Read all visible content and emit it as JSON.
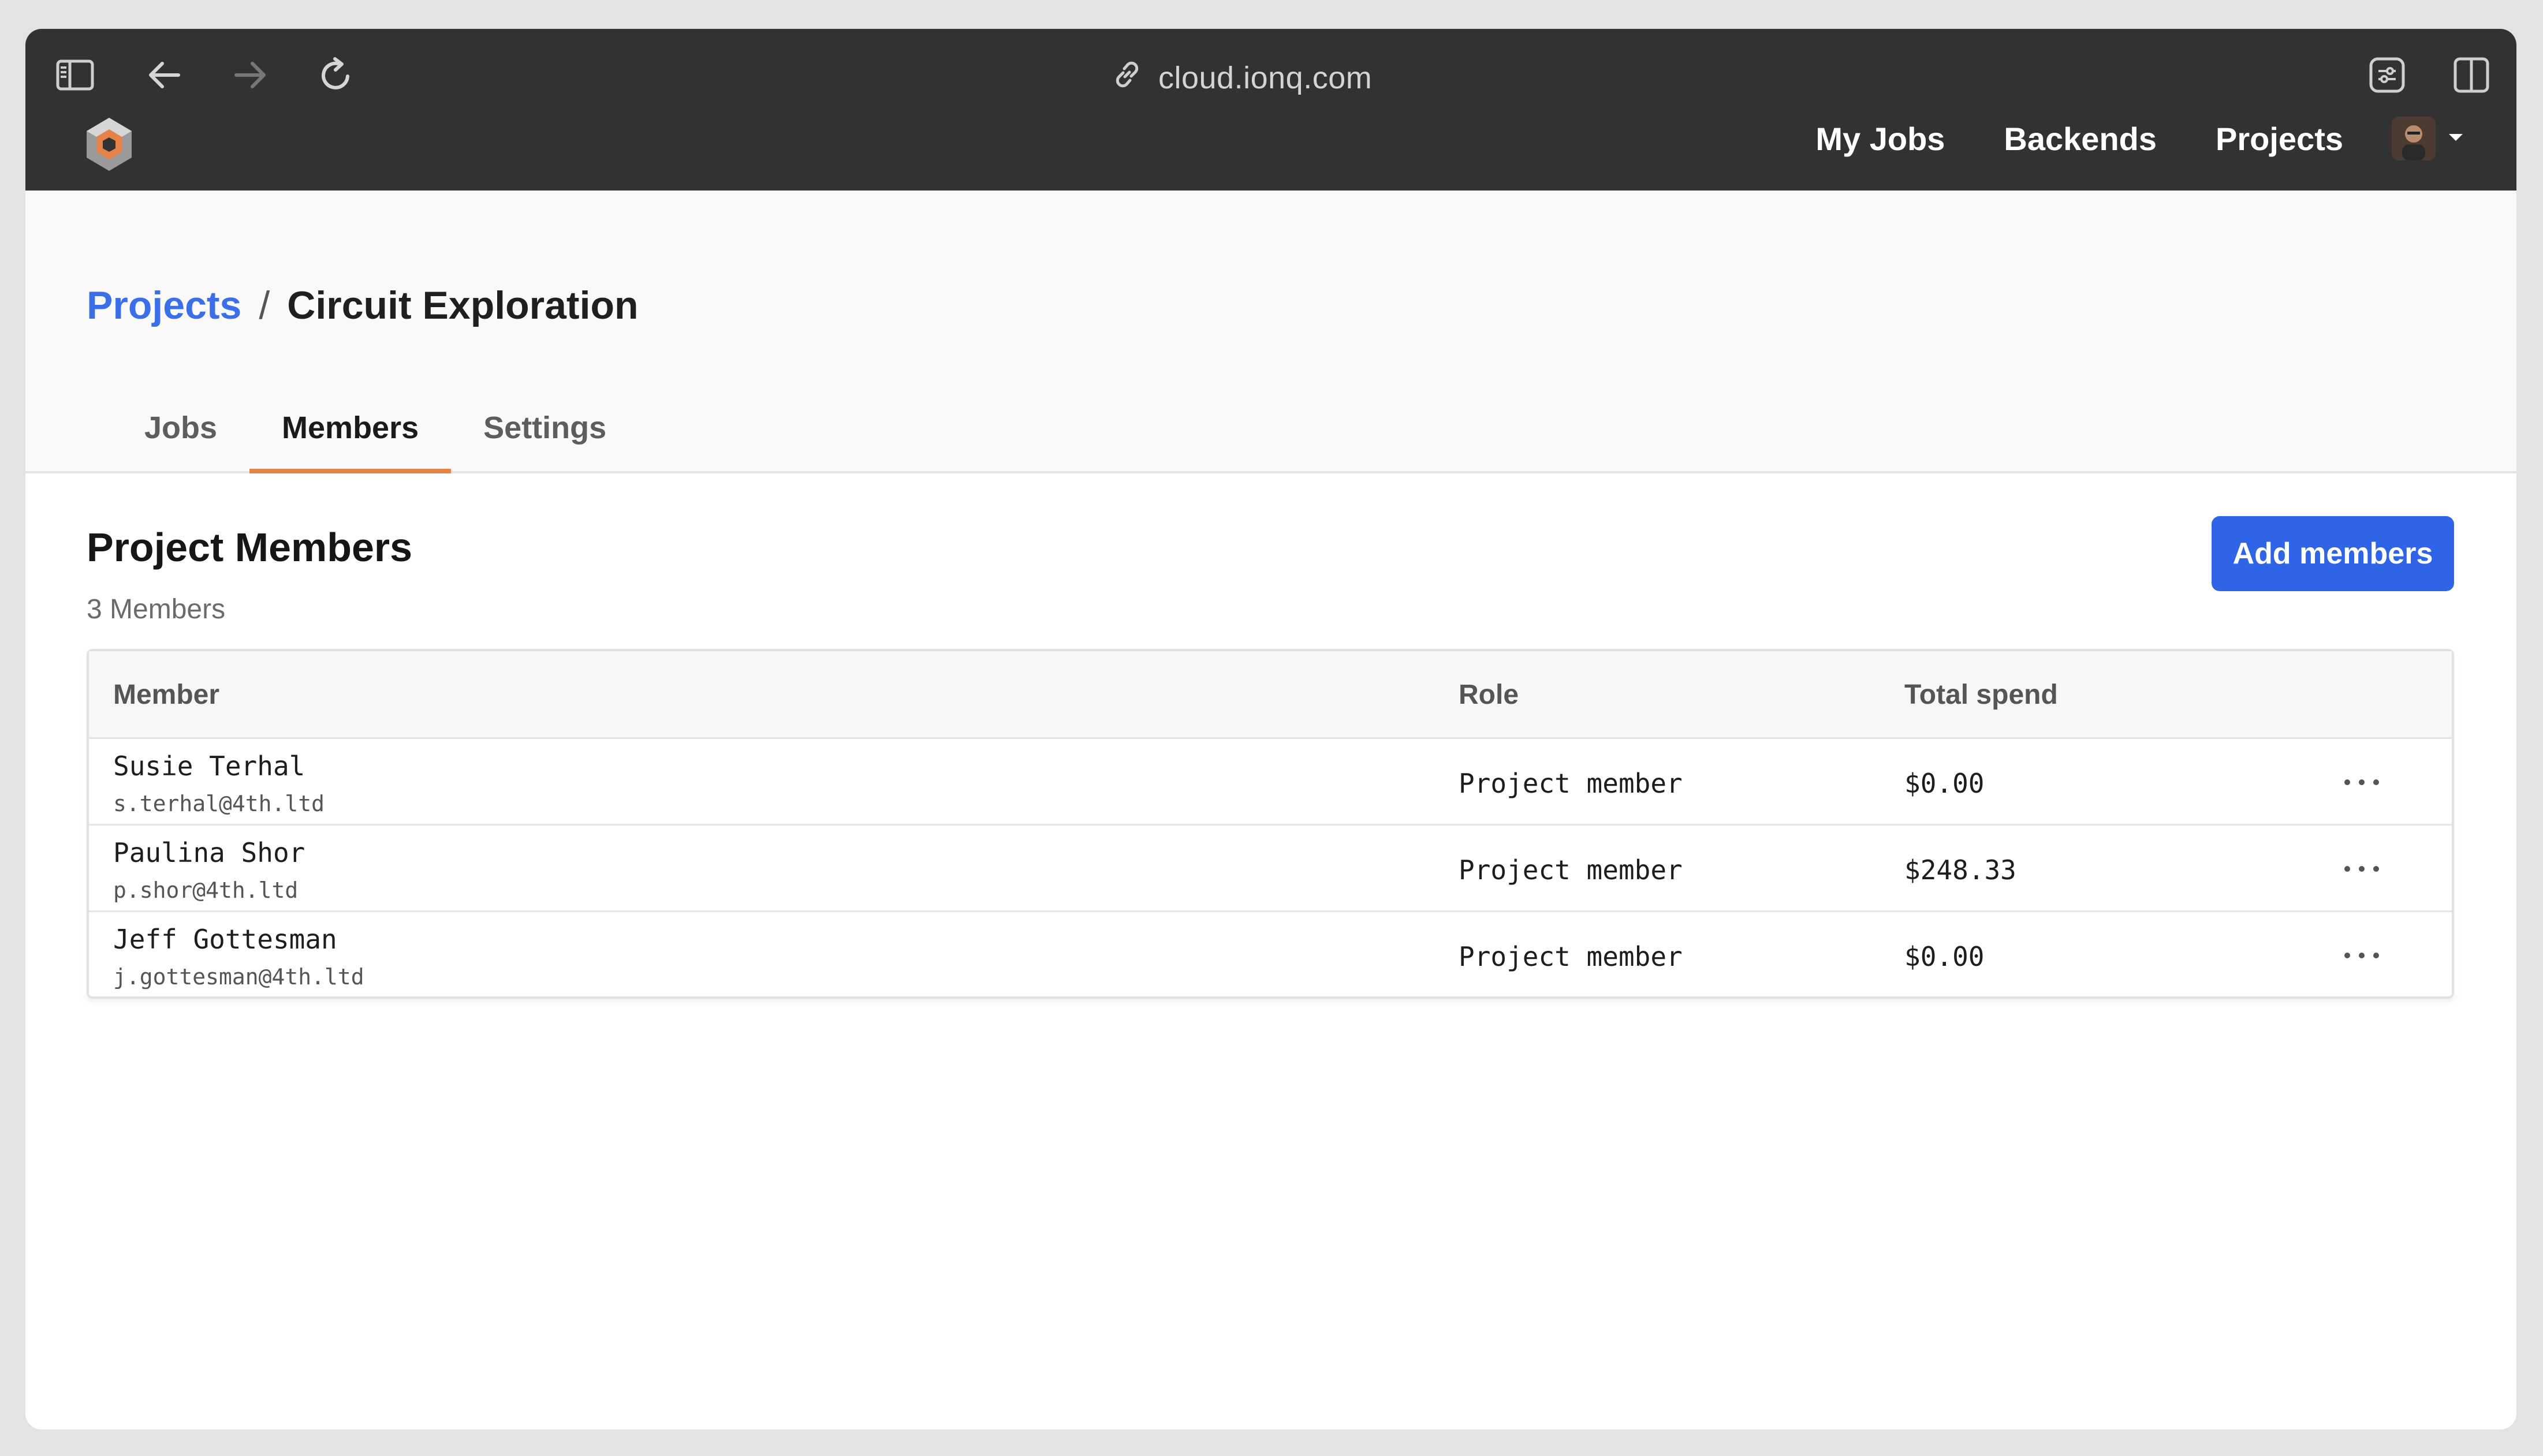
{
  "browser": {
    "url": "cloud.ionq.com",
    "icons": [
      "sidebar-icon",
      "back-arrow-icon",
      "forward-arrow-icon",
      "reload-icon",
      "link-icon",
      "extensions-icon",
      "split-view-icon"
    ]
  },
  "nav": {
    "items": [
      {
        "label": "My Jobs"
      },
      {
        "label": "Backends"
      },
      {
        "label": "Projects"
      }
    ]
  },
  "breadcrumb": {
    "parent": "Projects",
    "separator": "/",
    "current": "Circuit Exploration"
  },
  "tabs": [
    {
      "label": "Jobs",
      "active": false
    },
    {
      "label": "Members",
      "active": true
    },
    {
      "label": "Settings",
      "active": false
    }
  ],
  "members_section": {
    "title": "Project Members",
    "count_text": "3 Members",
    "add_button": "Add members"
  },
  "table": {
    "columns": [
      "Member",
      "Role",
      "Total spend"
    ],
    "rows": [
      {
        "name": "Susie Terhal",
        "email": "s.terhal@4th.ltd",
        "role": "Project member",
        "spend": "$0.00"
      },
      {
        "name": "Paulina Shor",
        "email": "p.shor@4th.ltd",
        "role": "Project member",
        "spend": "$248.33"
      },
      {
        "name": "Jeff Gottesman",
        "email": "j.gottesman@4th.ltd",
        "role": "Project member",
        "spend": "$0.00"
      }
    ]
  },
  "colors": {
    "chrome": "#323232",
    "accent_blue": "#2f64e6",
    "tab_underline": "#e58248",
    "logo_orange": "#e58248"
  }
}
